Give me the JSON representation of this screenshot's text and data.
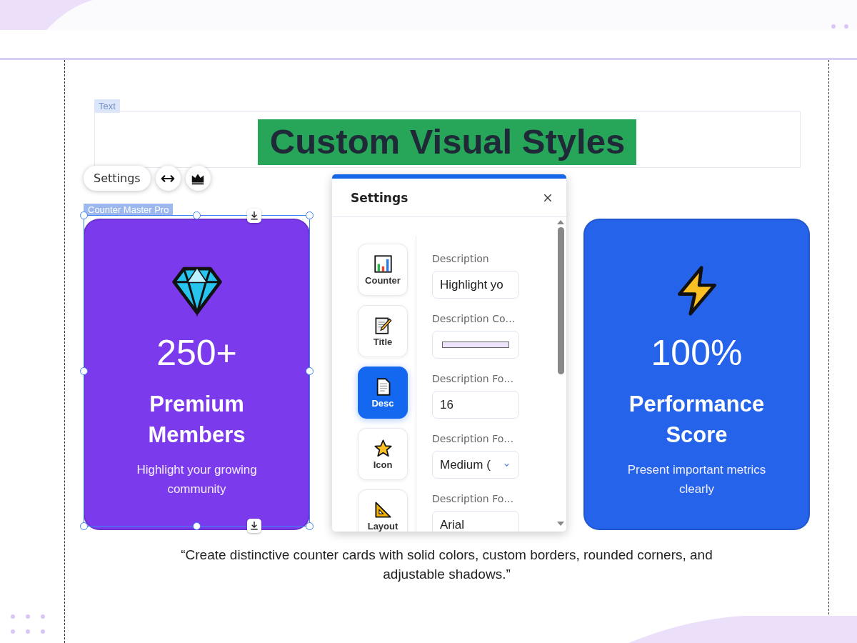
{
  "text_element": {
    "label": "Text",
    "heading": "Custom Visual Styles"
  },
  "toolbar": {
    "settings_button": "Settings"
  },
  "widget_label": "Counter Master Pro",
  "cards": [
    {
      "number": "250+",
      "title": "Premium Members",
      "description": "Highlight your growing community",
      "color": "#7c3aed"
    },
    {
      "number": "100%",
      "title": "Performance Score",
      "description": "Present important metrics clearly",
      "color": "#2563eb"
    }
  ],
  "settings_panel": {
    "title": "Settings",
    "tabs": [
      {
        "label": "Counter",
        "selected": false
      },
      {
        "label": "Title",
        "selected": false
      },
      {
        "label": "Desc",
        "selected": true
      },
      {
        "label": "Icon",
        "selected": false
      },
      {
        "label": "Layout",
        "selected": false
      }
    ],
    "fields": [
      {
        "label": "Description",
        "kind": "text",
        "value": "Highlight yo"
      },
      {
        "label": "Description Co…",
        "kind": "color",
        "color": "#ede4fb"
      },
      {
        "label": "Description Fo…",
        "kind": "text",
        "value": "16"
      },
      {
        "label": "Description Fo…",
        "kind": "dropdown",
        "value": "Medium ("
      },
      {
        "label": "Description Fo…",
        "kind": "text",
        "value": "Arial"
      }
    ]
  },
  "caption": "“Create distinctive counter cards with solid colors, custom borders, rounded corners, and adjustable shadows.”"
}
